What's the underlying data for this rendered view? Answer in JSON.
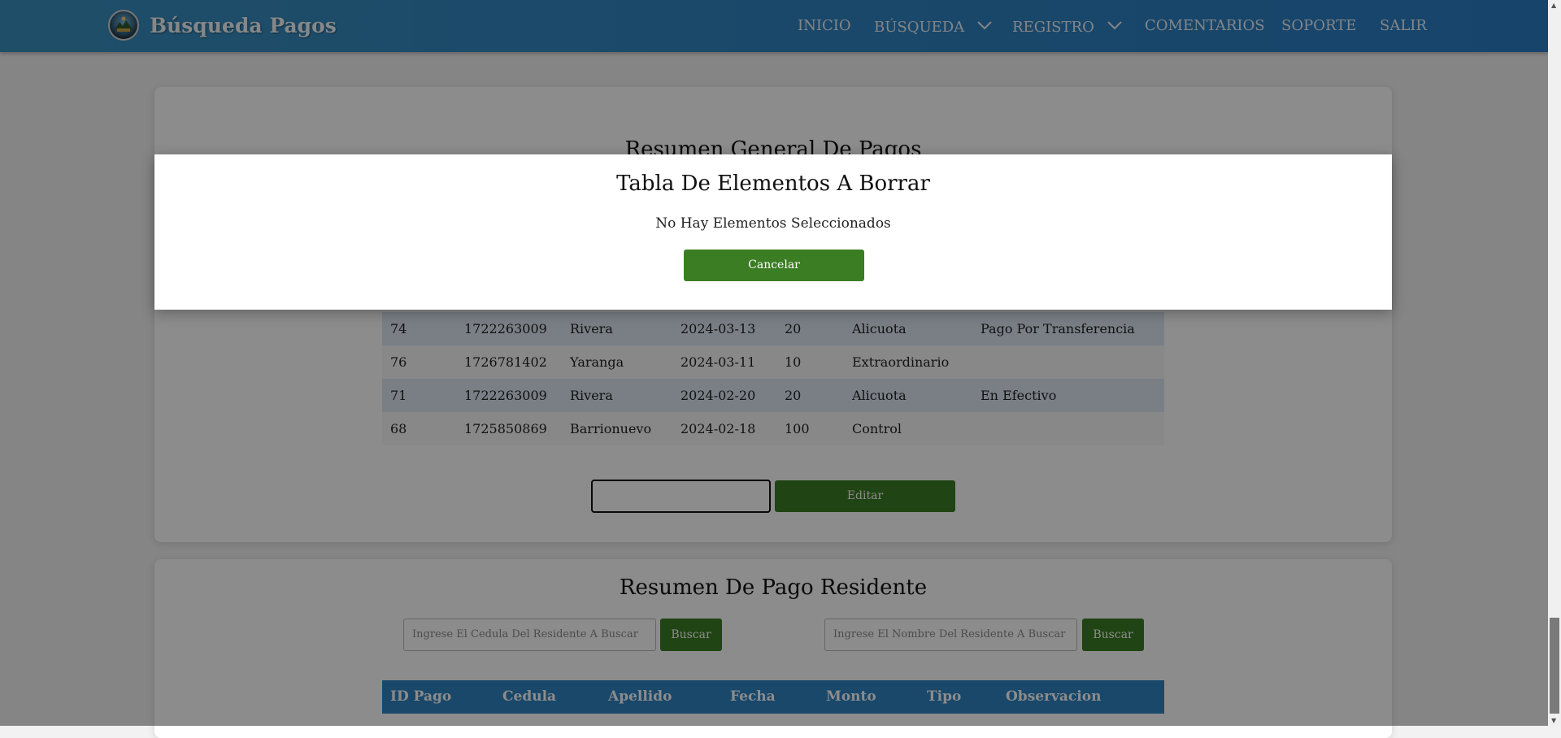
{
  "navbar": {
    "title": "Búsqueda Pagos",
    "items": [
      "INICIO",
      "BÚSQUEDA",
      "REGISTRO",
      "COMENTARIOS",
      "SOPORTE",
      "SALIR"
    ]
  },
  "summary": {
    "title": "Resumen General De Pagos",
    "rows": [
      [
        "74",
        "1722263009",
        "Rivera",
        "2024-03-13",
        "20",
        "Alicuota",
        "Pago Por Transferencia"
      ],
      [
        "76",
        "1726781402",
        "Yaranga",
        "2024-03-11",
        "10",
        "Extraordinario",
        ""
      ],
      [
        "71",
        "1722263009",
        "Rivera",
        "2024-02-20",
        "20",
        "Alicuota",
        "En Efectivo"
      ],
      [
        "68",
        "1725850869",
        "Barrionuevo",
        "2024-02-18",
        "100",
        "Control",
        ""
      ]
    ],
    "edit_label": "Editar"
  },
  "resident": {
    "title": "Resumen De Pago Residente",
    "cedula_placeholder": "Ingrese El Cedula Del Residente A Buscar",
    "name_placeholder": "Ingrese El Nombre Del Residente A Buscar",
    "search_label": "Buscar",
    "headers": [
      "ID Pago",
      "Cedula",
      "Apellido",
      "Fecha",
      "Monto",
      "Tipo",
      "Observacion"
    ]
  },
  "modal": {
    "title": "Tabla De Elementos A Borrar",
    "message": "No Hay Elementos Seleccionados",
    "cancel_label": "Cancelar"
  },
  "colors": {
    "navbar": "#2f83c2",
    "button_green": "#3b7d23",
    "row_alt": "#dce7f3",
    "table_header": "#2f83c2"
  },
  "icons": [
    "logo-icon",
    "chevron-down-icon"
  ]
}
